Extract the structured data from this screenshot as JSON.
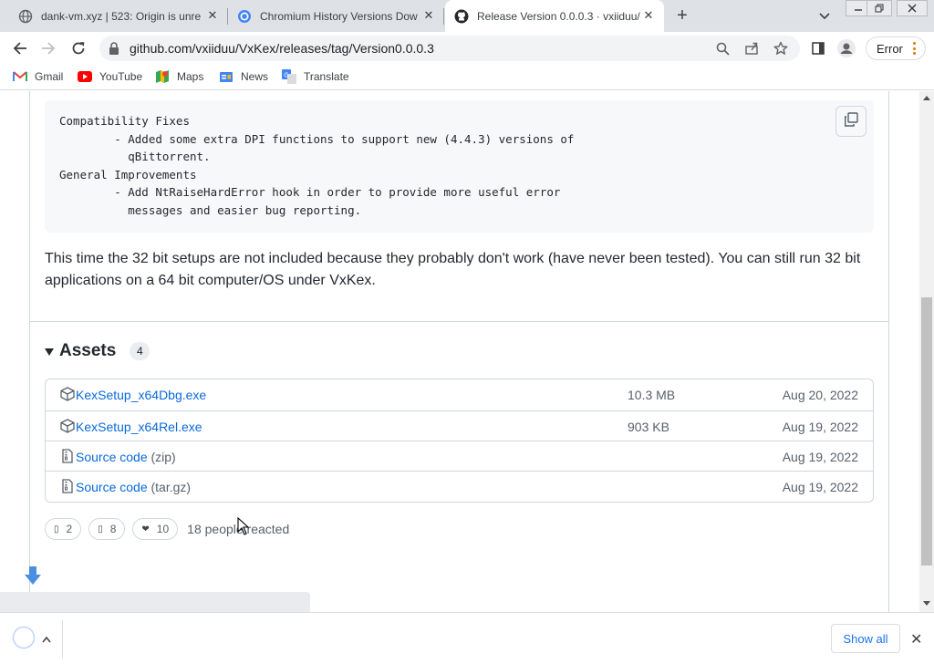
{
  "tabs": [
    {
      "title": "dank-vm.xyz | 523: Origin is unre",
      "icon": "globe-icon"
    },
    {
      "title": "Chromium History Versions Dow",
      "icon": "chromium-history-icon"
    },
    {
      "title": "Release Version 0.0.0.3 · vxiiduu/",
      "icon": "github-icon",
      "active": true
    }
  ],
  "toolbar": {
    "url": "github.com/vxiiduu/VxKex/releases/tag/Version0.0.0.3",
    "error_label": "Error"
  },
  "bookmarks": [
    {
      "label": "Gmail",
      "icon": "gmail-icon"
    },
    {
      "label": "YouTube",
      "icon": "youtube-icon"
    },
    {
      "label": "Maps",
      "icon": "maps-icon"
    },
    {
      "label": "News",
      "icon": "news-icon"
    },
    {
      "label": "Translate",
      "icon": "translate-icon"
    }
  ],
  "release": {
    "code_lines": [
      "Compatibility Fixes",
      "        - Added some extra DPI functions to support new (4.4.3) versions of",
      "          qBittorrent.",
      "General Improvements",
      "        - Add NtRaiseHardError hook in order to provide more useful error",
      "          messages and easier bug reporting."
    ],
    "paragraph": "This time the 32 bit setups are not included because they probably don't work (have never been tested). You can still run 32 bit applications on a 64 bit computer/OS under VxKex.",
    "assets_title": "Assets",
    "assets_count": "4",
    "assets": [
      {
        "name": "KexSetup_x64Dbg.exe",
        "suffix": "",
        "size": "10.3 MB",
        "date": "Aug 20, 2022",
        "icon": "package-icon"
      },
      {
        "name": "KexSetup_x64Rel.exe",
        "suffix": "",
        "size": "903 KB",
        "date": "Aug 19, 2022",
        "icon": "package-icon"
      },
      {
        "name": "Source code",
        "suffix": " (zip)",
        "size": "",
        "date": "Aug 19, 2022",
        "icon": "file-zip-icon"
      },
      {
        "name": "Source code",
        "suffix": " (tar.gz)",
        "size": "",
        "date": "Aug 19, 2022",
        "icon": "file-zip-icon"
      }
    ],
    "reactions": [
      {
        "emoji": "▯",
        "count": "2"
      },
      {
        "emoji": "▯",
        "count": "8"
      },
      {
        "emoji": "❤",
        "count": "10"
      }
    ],
    "reacted_text": "18 people reacted"
  },
  "download_shelf": {
    "show_all_label": "Show all"
  },
  "colors": {
    "link": "#0969da",
    "muted": "#57606a",
    "chrome_tabstrip": "#dee1e6",
    "accent_blue": "#1a73e8"
  }
}
